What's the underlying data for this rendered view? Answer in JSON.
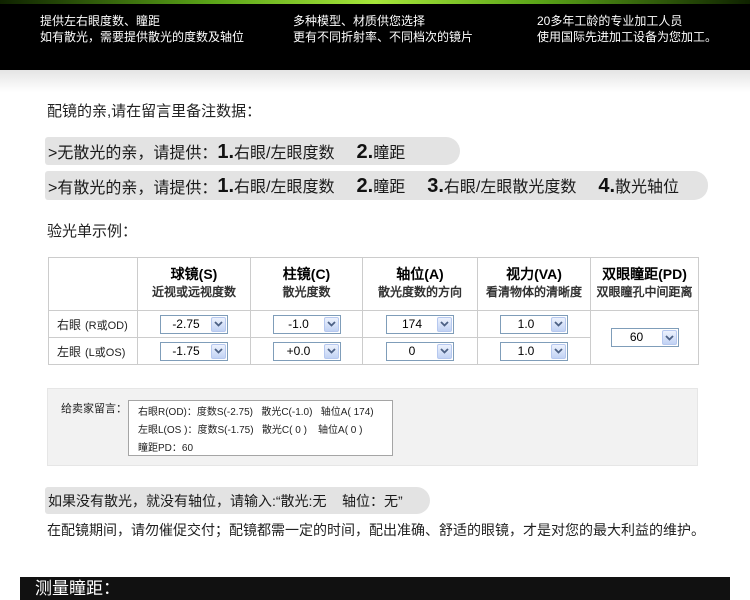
{
  "banner": {
    "columns": [
      {
        "line1": "提供左右眼度数、瞳距",
        "line2": "如有散光，需要提供散光的度数及轴位"
      },
      {
        "line1": "多种模型、材质供您选择",
        "line2": "更有不同折射率、不同档次的镜片"
      },
      {
        "line1": "20多年工龄的专业加工人员",
        "line2": "使用国际先进加工设备为您加工。"
      }
    ]
  },
  "intro_heading": "配镜的亲,请在留言里备注数据：",
  "no_astigmatism": {
    "prefix": ">无散光的亲，请提供：",
    "items": [
      {
        "num": "1.",
        "label": "右眼/左眼度数"
      },
      {
        "num": "2.",
        "label": "瞳距"
      }
    ]
  },
  "with_astigmatism": {
    "prefix": ">有散光的亲，请提供：",
    "items": [
      {
        "num": "1.",
        "label": "右眼/左眼度数"
      },
      {
        "num": "2.",
        "label": "瞳距"
      },
      {
        "num": "3.",
        "label": "右眼/左眼散光度数"
      },
      {
        "num": "4.",
        "label": "散光轴位"
      }
    ]
  },
  "example": {
    "heading": "验光单示例：",
    "columns": [
      {
        "title": "球镜(S)",
        "subtitle": "近视或远视度数"
      },
      {
        "title": "柱镜(C)",
        "subtitle": "散光度数"
      },
      {
        "title": "轴位(A)",
        "subtitle": "散光度数的方向"
      },
      {
        "title": "视力(VA)",
        "subtitle": "看清物体的清晰度"
      },
      {
        "title": "双眼瞳距(PD)",
        "subtitle": "双眼瞳孔中间距离"
      }
    ],
    "rows": [
      {
        "eye": "右眼",
        "code": "(R或OD)",
        "sphere": "-2.75",
        "cylinder": "-1.0",
        "axis": "174",
        "va": "1.0"
      },
      {
        "eye": "左眼",
        "code": "(L或OS)",
        "sphere": "-1.75",
        "cylinder": "+0.0",
        "axis": "0",
        "va": "1.0"
      }
    ],
    "pd": "60"
  },
  "seller_message": {
    "label": "给卖家留言：",
    "lines": [
      "右眼R(OD)：度数S(-2.75)   散光C(-1.0)   轴位A( 174)",
      "左眼L(OS )：度数S(-1.75)   散光C( 0 )    轴位A( 0 )",
      "瞳距PD：60"
    ]
  },
  "tip": "如果没有散光，就没有轴位，请输入:“散光:无    轴位：无”",
  "notice": "在配镜期间，请勿催促交付；配镜都需一定的时间，配出准确、舒适的眼镜，才是对您的最大利益的维护。",
  "section_title": "测量瞳距：",
  "icons": {
    "dropdown": "chevron-down-icon"
  },
  "colors": {
    "banner_bg": "#000000",
    "accent_green": "#a6e63a",
    "bar_bg": "#e3e3e3",
    "select_border": "#7f9db9",
    "section_bar_bg": "#111111"
  }
}
